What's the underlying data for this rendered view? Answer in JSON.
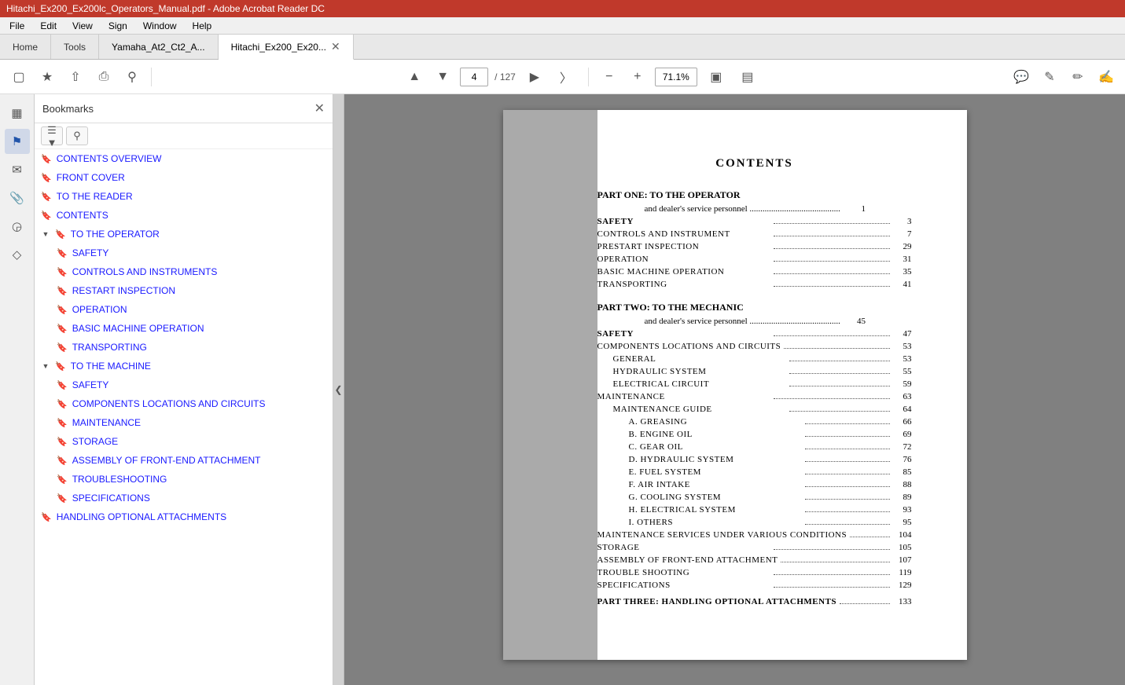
{
  "titleBar": {
    "text": "Hitachi_Ex200_Ex200lc_Operators_Manual.pdf - Adobe Acrobat Reader DC"
  },
  "menuBar": {
    "items": [
      "File",
      "Edit",
      "View",
      "Sign",
      "Window",
      "Help"
    ]
  },
  "tabs": [
    {
      "label": "Home",
      "type": "home"
    },
    {
      "label": "Tools",
      "type": "tools"
    },
    {
      "label": "Yamaha_At2_Ct2_A...",
      "type": "normal"
    },
    {
      "label": "Hitachi_Ex200_Ex20...",
      "type": "active",
      "closeable": true
    }
  ],
  "toolbar": {
    "pageNum": "4",
    "pageTotal": "127",
    "zoomLevel": "71.1%"
  },
  "bookmarks": {
    "title": "Bookmarks",
    "items": [
      {
        "label": "CONTENTS OVERVIEW",
        "indent": 0,
        "expandable": false
      },
      {
        "label": "FRONT COVER",
        "indent": 0,
        "expandable": false
      },
      {
        "label": "TO THE READER",
        "indent": 0,
        "expandable": false
      },
      {
        "label": "CONTENTS",
        "indent": 0,
        "expandable": false
      },
      {
        "label": "TO THE OPERATOR",
        "indent": 0,
        "expandable": true,
        "expanded": true
      },
      {
        "label": "SAFETY",
        "indent": 1,
        "expandable": false
      },
      {
        "label": "CONTROLS AND INSTRUMENTS",
        "indent": 1,
        "expandable": false
      },
      {
        "label": "RESTART INSPECTION",
        "indent": 1,
        "expandable": false
      },
      {
        "label": "OPERATION",
        "indent": 1,
        "expandable": false
      },
      {
        "label": "BASIC MACHINE OPERATION",
        "indent": 1,
        "expandable": false
      },
      {
        "label": "TRANSPORTING",
        "indent": 1,
        "expandable": false
      },
      {
        "label": "TO THE MACHINE",
        "indent": 0,
        "expandable": true,
        "expanded": true
      },
      {
        "label": "SAFETY",
        "indent": 1,
        "expandable": false
      },
      {
        "label": "COMPONENTS LOCATIONS AND CIRCUITS",
        "indent": 1,
        "expandable": false
      },
      {
        "label": "MAINTENANCE",
        "indent": 1,
        "expandable": false
      },
      {
        "label": "STORAGE",
        "indent": 1,
        "expandable": false
      },
      {
        "label": "ASSEMBLY OF FRONT-END ATTACHMENT",
        "indent": 1,
        "expandable": false
      },
      {
        "label": "TROUBLESHOOTING",
        "indent": 1,
        "expandable": false
      },
      {
        "label": "SPECIFICATIONS",
        "indent": 1,
        "expandable": false
      },
      {
        "label": "HANDLING OPTIONAL ATTACHMENTS",
        "indent": 0,
        "expandable": false
      }
    ]
  },
  "pdf": {
    "toc": {
      "title": "CONTENTS",
      "part1": {
        "heading": "PART ONE:   TO THE OPERATOR",
        "subtitle": "and dealer's service personnel ..........................................",
        "subtitlePage": "1",
        "entries": [
          {
            "label": "SAFETY",
            "dots": true,
            "page": "3",
            "bold": true
          },
          {
            "label": "CONTROLS AND INSTRUMENT",
            "dots": true,
            "page": "7"
          },
          {
            "label": "PRESTART INSPECTION",
            "dots": true,
            "page": "29"
          },
          {
            "label": "OPERATION",
            "dots": true,
            "page": "31"
          },
          {
            "label": "BASIC MACHINE OPERATION",
            "dots": true,
            "page": "35"
          },
          {
            "label": "TRANSPORTING",
            "dots": true,
            "page": "41"
          }
        ]
      },
      "part2": {
        "heading": "PART TWO:   TO THE MECHANIC",
        "subtitle": "and dealer's service personnel ..........................................",
        "subtitlePage": "45",
        "entries": [
          {
            "label": "SAFETY",
            "dots": true,
            "page": "47",
            "bold": true
          },
          {
            "label": "COMPONENTS LOCATIONS AND CIRCUITS",
            "dots": true,
            "page": "53"
          },
          {
            "label": "GENERAL",
            "dots": true,
            "page": "53",
            "sub": true
          },
          {
            "label": "HYDRAULIC SYSTEM",
            "dots": true,
            "page": "55",
            "sub": true
          },
          {
            "label": "ELECTRICAL CIRCUIT",
            "dots": true,
            "page": "59",
            "sub": true
          },
          {
            "label": "MAINTENANCE",
            "dots": true,
            "page": "63"
          },
          {
            "label": "MAINTENANCE GUIDE",
            "dots": true,
            "page": "64",
            "sub": true
          },
          {
            "label": "A.  GREASING",
            "dots": true,
            "page": "66",
            "sub2": true
          },
          {
            "label": "B.  ENGINE OIL",
            "dots": true,
            "page": "69",
            "sub2": true
          },
          {
            "label": "C.  GEAR OIL",
            "dots": true,
            "page": "72",
            "sub2": true
          },
          {
            "label": "D.  HYDRAULIC SYSTEM",
            "dots": true,
            "page": "76",
            "sub2": true
          },
          {
            "label": "E.  FUEL SYSTEM",
            "dots": true,
            "page": "85",
            "sub2": true
          },
          {
            "label": "F.  AIR INTAKE",
            "dots": true,
            "page": "88",
            "sub2": true
          },
          {
            "label": "G.  COOLING SYSTEM",
            "dots": true,
            "page": "89",
            "sub2": true
          },
          {
            "label": "H.  ELECTRICAL SYSTEM",
            "dots": true,
            "page": "93",
            "sub2": true
          },
          {
            "label": "I.  OTHERS",
            "dots": true,
            "page": "95",
            "sub2": true
          },
          {
            "label": "MAINTENANCE SERVICES UNDER VARIOUS CONDITIONS",
            "dots": true,
            "page": "104"
          },
          {
            "label": "STORAGE",
            "dots": true,
            "page": "105"
          },
          {
            "label": "ASSEMBLY OF FRONT-END ATTACHMENT",
            "dots": true,
            "page": "107"
          },
          {
            "label": "TROUBLE SHOOTING",
            "dots": true,
            "page": "119"
          },
          {
            "label": "SPECIFICATIONS",
            "dots": true,
            "page": "129"
          },
          {
            "label": "PART THREE: HANDLING OPTIONAL ATTACHMENTS",
            "dots": true,
            "page": "133",
            "bold": true
          }
        ]
      }
    }
  }
}
